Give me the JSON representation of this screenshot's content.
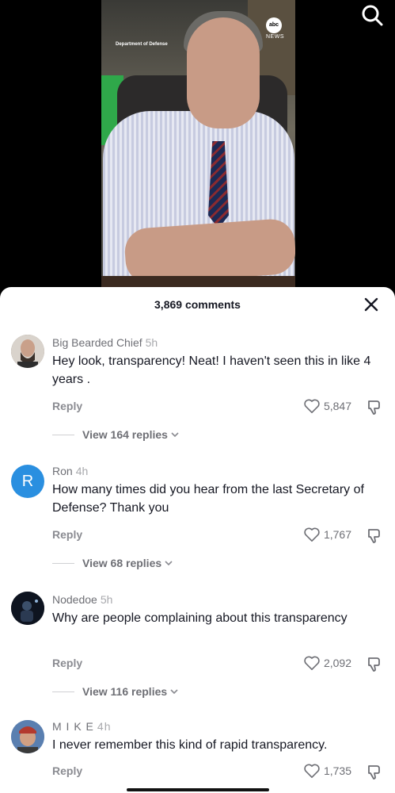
{
  "video": {
    "overlay_left": "Department of Defense",
    "overlay_logo": "abc",
    "overlay_right": "NEWS"
  },
  "top_bar": {
    "search_icon": "search-icon"
  },
  "sheet": {
    "count_label": "3,869 comments",
    "close_icon": "close-icon"
  },
  "comments": [
    {
      "user": "Big Bearded Chief",
      "time": "5h",
      "text": "Hey look, transparency! Neat! I haven't seen this in like 4 years .",
      "reply_label": "Reply",
      "likes": "5,847",
      "view_replies": "View 164 replies"
    },
    {
      "user": "Ron",
      "time": "4h",
      "avatar_letter": "R",
      "text": "How many times did you hear from the last Secretary of Defense? Thank you",
      "reply_label": "Reply",
      "likes": "1,767",
      "view_replies": "View 68 replies"
    },
    {
      "user": "Nodedoe",
      "time": "5h",
      "text": "Why are people complaining about this transparency",
      "reply_label": "Reply",
      "likes": "2,092",
      "view_replies": "View 116 replies"
    },
    {
      "user": "M I K E",
      "time": "4h",
      "text": "I never remember this kind of rapid transparency.",
      "reply_label": "Reply",
      "likes": "1,735"
    }
  ],
  "colors": {
    "accent_avatar_blue": "#2a8fe0",
    "text_primary": "#161823",
    "text_secondary": "#6e6f75"
  }
}
